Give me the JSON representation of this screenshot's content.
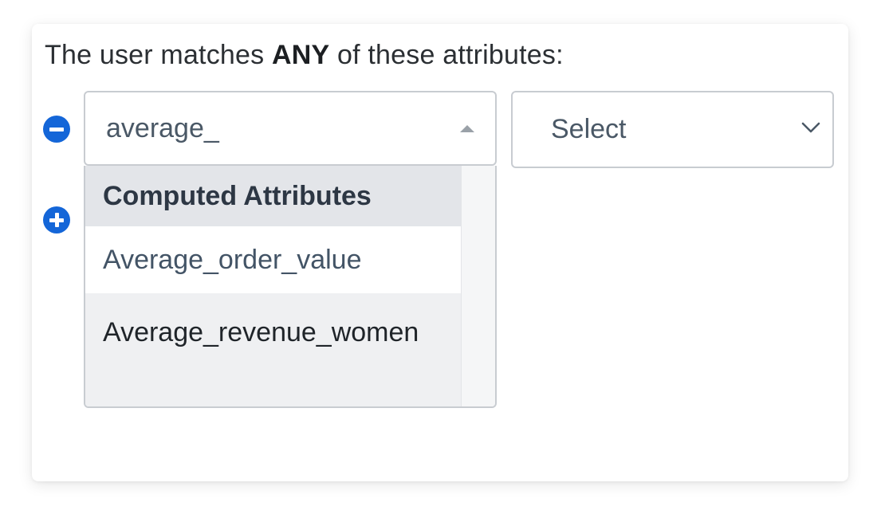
{
  "heading": {
    "prefix": "The user matches ",
    "emphasis": "ANY",
    "suffix": " of these attributes:"
  },
  "rule_row": {
    "remove_button_icon": "minus-circle-icon",
    "add_button_icon": "plus-circle-icon",
    "attribute_combobox": {
      "value": "average_",
      "expanded": true,
      "caret_icon": "caret-up-icon"
    },
    "dropdown": {
      "group_label": "Computed Attributes",
      "options": [
        {
          "label": "Average_order_value"
        },
        {
          "label": "Average_revenue_women",
          "highlighted": true
        }
      ]
    },
    "operator_select": {
      "label": "Select",
      "chevron_icon": "chevron-down-icon"
    }
  },
  "colors": {
    "accent": "#1466d8",
    "border": "#c8ccd1",
    "group_header_bg": "#e3e5e9",
    "highlight_bg": "#eff0f2"
  }
}
